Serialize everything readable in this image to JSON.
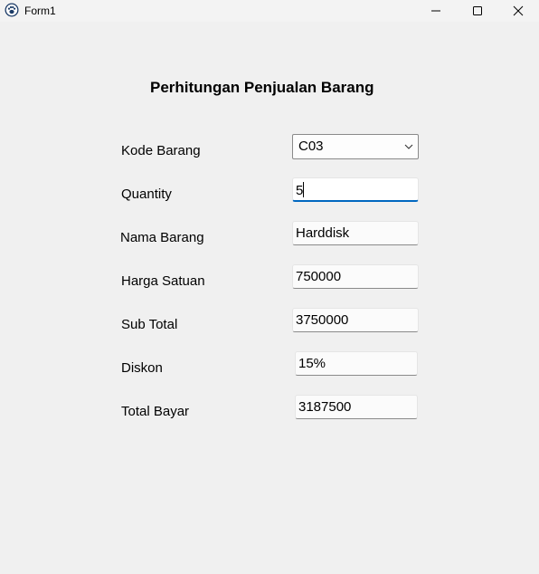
{
  "window": {
    "title": "Form1",
    "minimize_glyph": "—",
    "maximize_glyph": "☐",
    "close_glyph": "✕"
  },
  "form": {
    "heading": "Perhitungan Penjualan Barang",
    "fields": {
      "kode_barang": {
        "label": "Kode Barang",
        "value": "C03"
      },
      "quantity": {
        "label": "Quantity",
        "value": "5"
      },
      "nama_barang": {
        "label": "Nama Barang",
        "value": "Harddisk"
      },
      "harga_satuan": {
        "label": "Harga Satuan",
        "value": "750000"
      },
      "sub_total": {
        "label": "Sub Total",
        "value": "3750000"
      },
      "diskon": {
        "label": "Diskon",
        "value": "15%"
      },
      "total_bayar": {
        "label": "Total Bayar",
        "value": "3187500"
      }
    }
  },
  "icons": {
    "app": "paw-icon",
    "dropdown": "chevron-down-icon"
  },
  "colors": {
    "background": "#f0f0f0",
    "focus_accent": "#0067c0"
  }
}
